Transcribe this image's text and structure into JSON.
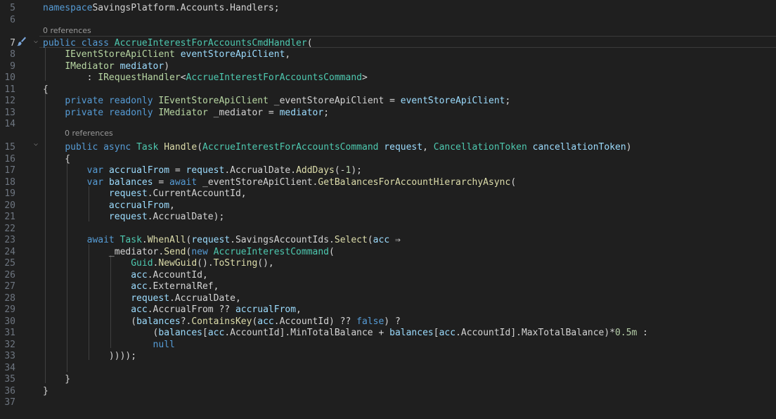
{
  "editor": {
    "codelens": [
      "0 references",
      "0 references"
    ],
    "lines": [
      {
        "num": "5",
        "tokens": [
          [
            "k",
            "namespace"
          ],
          [
            "",
            "SavingsPlatform.Accounts.Handlers;"
          ]
        ]
      },
      {
        "num": "6",
        "tokens": []
      },
      {
        "num": "7",
        "tokens": [
          [
            "k",
            "public "
          ],
          [
            "k",
            "class "
          ],
          [
            "t",
            "AccrueInterestForAccountsCmdHandler"
          ],
          [
            "",
            "("
          ]
        ]
      },
      {
        "num": "8",
        "tokens": [
          [
            "",
            "    "
          ],
          [
            "i",
            "IEventStoreApiClient"
          ],
          [
            "",
            " "
          ],
          [
            "p",
            "eventStoreApiClient"
          ],
          [
            "",
            ","
          ]
        ]
      },
      {
        "num": "9",
        "tokens": [
          [
            "",
            "    "
          ],
          [
            "i",
            "IMediator"
          ],
          [
            "",
            " "
          ],
          [
            "p",
            "mediator"
          ],
          [
            "",
            ")"
          ]
        ]
      },
      {
        "num": "10",
        "tokens": [
          [
            "",
            "        : "
          ],
          [
            "i",
            "IRequestHandler"
          ],
          [
            "",
            "<"
          ],
          [
            "t",
            "AccrueInterestForAccountsCommand"
          ],
          [
            "",
            ">"
          ]
        ]
      },
      {
        "num": "11",
        "tokens": [
          [
            "",
            "{"
          ]
        ]
      },
      {
        "num": "12",
        "tokens": [
          [
            "",
            "    "
          ],
          [
            "k",
            "private "
          ],
          [
            "k",
            "readonly "
          ],
          [
            "i",
            "IEventStoreApiClient"
          ],
          [
            "",
            " _eventStoreApiClient = "
          ],
          [
            "p",
            "eventStoreApiClient"
          ],
          [
            "",
            ";"
          ]
        ]
      },
      {
        "num": "13",
        "tokens": [
          [
            "",
            "    "
          ],
          [
            "k",
            "private "
          ],
          [
            "k",
            "readonly "
          ],
          [
            "i",
            "IMediator"
          ],
          [
            "",
            " _mediator = "
          ],
          [
            "p",
            "mediator"
          ],
          [
            "",
            ";"
          ]
        ]
      },
      {
        "num": "14",
        "tokens": []
      },
      {
        "num": "15",
        "tokens": [
          [
            "",
            "    "
          ],
          [
            "k",
            "public "
          ],
          [
            "k",
            "async "
          ],
          [
            "t",
            "Task"
          ],
          [
            "",
            " "
          ],
          [
            "m",
            "Handle"
          ],
          [
            "",
            "("
          ],
          [
            "t",
            "AccrueInterestForAccountsCommand"
          ],
          [
            "",
            " "
          ],
          [
            "p",
            "request"
          ],
          [
            "",
            ", "
          ],
          [
            "t",
            "CancellationToken"
          ],
          [
            "",
            " "
          ],
          [
            "p",
            "cancellationToken"
          ],
          [
            "",
            ")"
          ]
        ]
      },
      {
        "num": "16",
        "tokens": [
          [
            "",
            "    {"
          ]
        ]
      },
      {
        "num": "17",
        "tokens": [
          [
            "",
            "        "
          ],
          [
            "k",
            "var "
          ],
          [
            "p",
            "accrualFrom"
          ],
          [
            "",
            " = "
          ],
          [
            "p",
            "request"
          ],
          [
            "",
            ".AccrualDate."
          ],
          [
            "m",
            "AddDays"
          ],
          [
            "",
            "(-"
          ],
          [
            "n",
            "1"
          ],
          [
            "",
            ");"
          ]
        ]
      },
      {
        "num": "18",
        "tokens": [
          [
            "",
            "        "
          ],
          [
            "k",
            "var "
          ],
          [
            "p",
            "balances"
          ],
          [
            "",
            " = "
          ],
          [
            "k",
            "await"
          ],
          [
            "",
            " _eventStoreApiClient."
          ],
          [
            "m",
            "GetBalancesForAccountHierarchyAsync"
          ],
          [
            "",
            "("
          ]
        ]
      },
      {
        "num": "19",
        "tokens": [
          [
            "",
            "            "
          ],
          [
            "p",
            "request"
          ],
          [
            "",
            ".CurrentAccountId,"
          ]
        ]
      },
      {
        "num": "20",
        "tokens": [
          [
            "",
            "            "
          ],
          [
            "p",
            "accrualFrom"
          ],
          [
            "",
            ","
          ]
        ]
      },
      {
        "num": "21",
        "tokens": [
          [
            "",
            "            "
          ],
          [
            "p",
            "request"
          ],
          [
            "",
            ".AccrualDate);"
          ]
        ]
      },
      {
        "num": "22",
        "tokens": []
      },
      {
        "num": "23",
        "tokens": [
          [
            "",
            "        "
          ],
          [
            "k",
            "await "
          ],
          [
            "t",
            "Task"
          ],
          [
            "",
            "."
          ],
          [
            "m",
            "WhenAll"
          ],
          [
            "",
            "("
          ],
          [
            "p",
            "request"
          ],
          [
            "",
            ".SavingsAccountIds."
          ],
          [
            "m",
            "Select"
          ],
          [
            "",
            "("
          ],
          [
            "p",
            "acc"
          ],
          [
            "",
            " ⇒"
          ]
        ]
      },
      {
        "num": "24",
        "tokens": [
          [
            "",
            "            _mediator."
          ],
          [
            "m",
            "Send"
          ],
          [
            "",
            "("
          ],
          [
            "k",
            "new "
          ],
          [
            "t",
            "AccrueInterestCommand"
          ],
          [
            "",
            "("
          ]
        ]
      },
      {
        "num": "25",
        "tokens": [
          [
            "",
            "                "
          ],
          [
            "t",
            "Guid"
          ],
          [
            "",
            "."
          ],
          [
            "m",
            "NewGuid"
          ],
          [
            "",
            "()."
          ],
          [
            "m",
            "ToString"
          ],
          [
            "",
            "(),"
          ]
        ]
      },
      {
        "num": "26",
        "tokens": [
          [
            "",
            "                "
          ],
          [
            "p",
            "acc"
          ],
          [
            "",
            ".AccountId,"
          ]
        ]
      },
      {
        "num": "27",
        "tokens": [
          [
            "",
            "                "
          ],
          [
            "p",
            "acc"
          ],
          [
            "",
            ".ExternalRef,"
          ]
        ]
      },
      {
        "num": "28",
        "tokens": [
          [
            "",
            "                "
          ],
          [
            "p",
            "request"
          ],
          [
            "",
            ".AccrualDate,"
          ]
        ]
      },
      {
        "num": "29",
        "tokens": [
          [
            "",
            "                "
          ],
          [
            "p",
            "acc"
          ],
          [
            "",
            ".AccrualFrom ?? "
          ],
          [
            "p",
            "accrualFrom"
          ],
          [
            "",
            ","
          ]
        ]
      },
      {
        "num": "30",
        "tokens": [
          [
            "",
            "                ("
          ],
          [
            "p",
            "balances"
          ],
          [
            "",
            "?."
          ],
          [
            "m",
            "ContainsKey"
          ],
          [
            "",
            "("
          ],
          [
            "p",
            "acc"
          ],
          [
            "",
            ".AccountId) ?? "
          ],
          [
            "k",
            "false"
          ],
          [
            "",
            ") ?"
          ]
        ]
      },
      {
        "num": "31",
        "tokens": [
          [
            "",
            "                    ("
          ],
          [
            "p",
            "balances"
          ],
          [
            "",
            "["
          ],
          [
            "p",
            "acc"
          ],
          [
            "",
            ".AccountId].MinTotalBalance + "
          ],
          [
            "p",
            "balances"
          ],
          [
            "",
            "["
          ],
          [
            "p",
            "acc"
          ],
          [
            "",
            ".AccountId].MaxTotalBalance)*"
          ],
          [
            "n",
            "0.5m"
          ],
          [
            "",
            " :"
          ]
        ]
      },
      {
        "num": "32",
        "tokens": [
          [
            "",
            "                    "
          ],
          [
            "k",
            "null"
          ]
        ]
      },
      {
        "num": "33",
        "tokens": [
          [
            "",
            "            ))));"
          ]
        ]
      },
      {
        "num": "34",
        "tokens": []
      },
      {
        "num": "35",
        "tokens": [
          [
            "",
            "    }"
          ]
        ]
      },
      {
        "num": "36",
        "tokens": [
          [
            "",
            "}"
          ]
        ]
      },
      {
        "num": "37",
        "tokens": []
      }
    ]
  },
  "colors": {
    "background": "#1f1f1f",
    "keyword": "#569cd6",
    "type": "#4ec9b0",
    "interface": "#b8d7a3",
    "method": "#dcdcaa",
    "parameter": "#9cdcfe",
    "number": "#b5cea8",
    "line_number": "#6e7681"
  },
  "icons": {
    "gutter": "paintbrush-icon",
    "fold": "chevron-down-icon"
  }
}
